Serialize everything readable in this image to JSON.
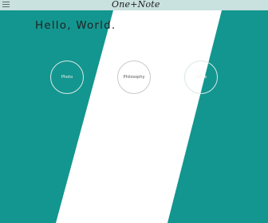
{
  "header": {
    "menu_icon": "hamburger-menu-icon",
    "logo_text": "One+Note"
  },
  "hero": {
    "greeting": "Hello, World."
  },
  "nav_circles": [
    {
      "label": "Photo"
    },
    {
      "label": "Philosophy"
    },
    {
      "label": "Office"
    }
  ],
  "colors": {
    "background": "#13968f",
    "stripe": "#ffffff",
    "topbar": "#c9e1df"
  }
}
